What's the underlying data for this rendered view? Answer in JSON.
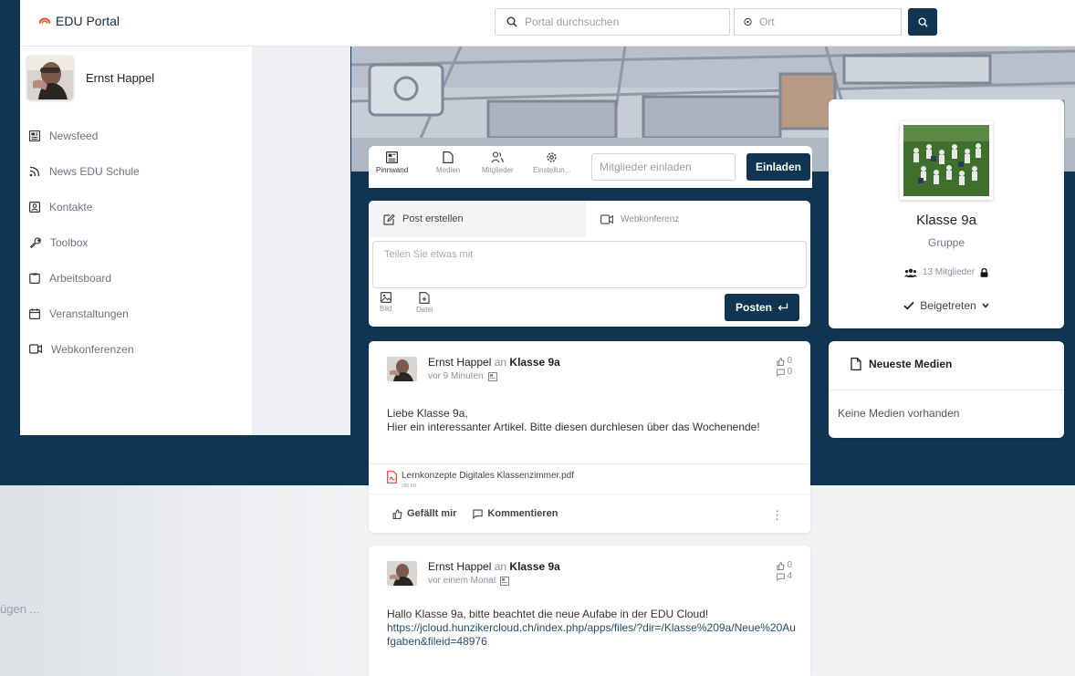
{
  "app": {
    "brand": "EDU Portal"
  },
  "search": {
    "portal_placeholder": "Portal durchsuchen",
    "ort_placeholder": "Ort"
  },
  "user": {
    "name": "Ernst Happel"
  },
  "sidebar": {
    "items": [
      {
        "label": "Newsfeed",
        "icon": "newspaper-icon"
      },
      {
        "label": "News EDU Schule",
        "icon": "rss-icon"
      },
      {
        "label": "Kontakte",
        "icon": "contacts-icon"
      },
      {
        "label": "Toolbox",
        "icon": "wrench-icon"
      },
      {
        "label": "Arbeitsboard",
        "icon": "clipboard-icon"
      },
      {
        "label": "Veranstaltungen",
        "icon": "calendar-icon"
      },
      {
        "label": "Webkonferenzen",
        "icon": "video-icon"
      }
    ]
  },
  "behind_text": "ügen ...",
  "group_tabs": {
    "items": [
      {
        "label": "Pinnwand",
        "active": true
      },
      {
        "label": "Medien"
      },
      {
        "label": "Mitglieder"
      },
      {
        "label": "Einstellun..."
      }
    ],
    "invite_placeholder": "Mitglieder einladen",
    "invite_label": "Einladen"
  },
  "composer": {
    "tab_post": "Post erstellen",
    "tab_webconf": "Webkonferenz",
    "placeholder": "Teilen Sie etwas mit",
    "attach_image": "Bild",
    "attach_file": "Datei",
    "post_label": "Posten"
  },
  "posts": [
    {
      "author": "Ernst Happel",
      "connector": "an",
      "group": "Klasse 9a",
      "time": "vor 9 Minuten",
      "likes": "0",
      "comments": "0",
      "body_line1": "Liebe Klasse 9a,",
      "body_line2": "Hier ein interessanter Artikel. Bitte diesen durchlesen über das Wochenende!",
      "attachment_name": "Lernkonzepte Digitales Klassenzimmer.pdf",
      "attachment_size": "280 KB",
      "like_label": "Gefällt mir",
      "comment_label": "Kommentieren"
    },
    {
      "author": "Ernst Happel",
      "connector": "an",
      "group": "Klasse 9a",
      "time": "vor einem Monat",
      "likes": "0",
      "comments": "4",
      "body_line1": "Hallo Klasse 9a, bitte beachtet die neue Aufabe in der EDU Cloud!",
      "link": "https://jcloud.hunzikercloud.ch/index.php/apps/files/?dir=/Klasse%209a/Neue%20Aufgaben&fileid=48976"
    }
  ],
  "group": {
    "name": "Klasse 9a",
    "type": "Gruppe",
    "members": "13 Mitglieder",
    "joined_label": "Beigetreten"
  },
  "media": {
    "title": "Neueste Medien",
    "empty": "Keine Medien vorhanden"
  },
  "colors": {
    "navy": "#0f3553",
    "accent": "#e8532b"
  }
}
